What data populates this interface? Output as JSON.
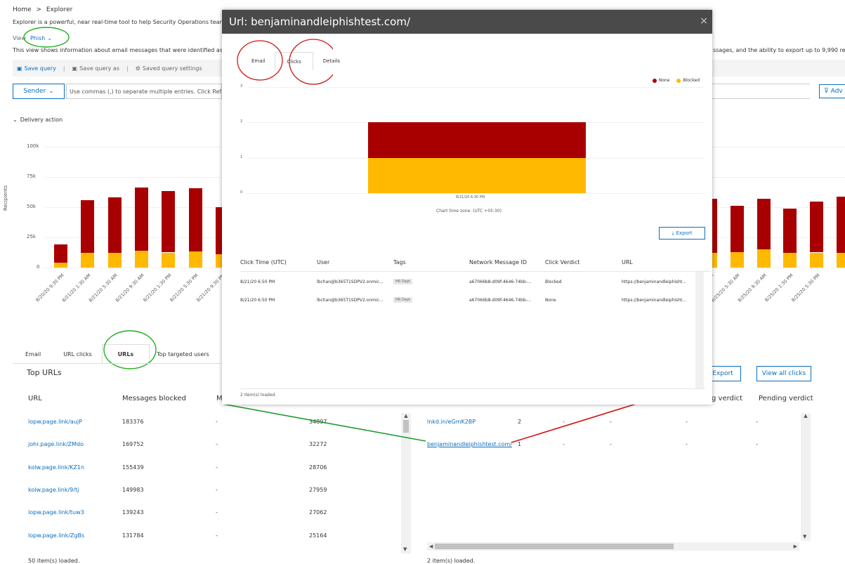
{
  "bg": {
    "breadcrumb": {
      "home": "Home",
      "sep": ">",
      "current": "Explorer"
    },
    "intro": "Explorer is a powerful, near real-time tool to help Security Operations team",
    "view_label": "View",
    "view_value": "Phish",
    "desc_left": "This view shows information about email messages that were identified as",
    "desc_right": "ssages, and the ability to export up to 9,990 rec",
    "toolbar": {
      "save_query": "Save query",
      "save_query_as": "Save query as",
      "saved_settings": "Saved query settings"
    },
    "filter": {
      "sender": "Sender",
      "placeholder": "Use commas (,) to separate multiple entries. Click Refr",
      "advanced": "Adv"
    },
    "delivery_action": "Delivery action",
    "chart": {
      "ylabel": "Recipients",
      "yticks": [
        "100k",
        "75k",
        "50k",
        "25k",
        "0"
      ],
      "ymax": 100000,
      "colors": {
        "red": "#a80000",
        "yellow": "#ffb900"
      },
      "left_bars": [
        {
          "red": 15000,
          "yellow": 4000
        },
        {
          "red": 44000,
          "yellow": 12000
        },
        {
          "red": 46000,
          "yellow": 12000
        },
        {
          "red": 52000,
          "yellow": 14000
        },
        {
          "red": 51000,
          "yellow": 12500
        },
        {
          "red": 52000,
          "yellow": 13500
        },
        {
          "red": 39000,
          "yellow": 11000
        }
      ],
      "left_xticks": [
        "8/20/20 9:30 PM",
        "8/21/20 1:30 AM",
        "8/21/20 5:30 AM",
        "8/21/20 9:30 AM",
        "8/21/20 1:30 PM",
        "8/21/20 5:30 PM",
        "8/21/20 9:30 PM"
      ],
      "right_bars": [
        {
          "red": 45000,
          "yellow": 12000
        },
        {
          "red": 38000,
          "yellow": 13000
        },
        {
          "red": 42000,
          "yellow": 15000
        },
        {
          "red": 37000,
          "yellow": 12000
        },
        {
          "red": 42000,
          "yellow": 12500
        },
        {
          "red": 47000,
          "yellow": 12000
        }
      ],
      "right_xticks": [
        "8/25/20 1:30 AM",
        "8/25/20 5:30 AM",
        "8/25/20 9:30 AM",
        "8/25/20 1:30 PM",
        "8/25/20 5:30 PM"
      ]
    },
    "tabs": [
      "Email",
      "URL clicks",
      "URLs",
      "Top targeted users"
    ],
    "top_urls_title": "Top URLs",
    "table_headers": [
      "URL",
      "Messages blocked",
      "M"
    ],
    "rows": [
      {
        "url": "lopw.page.link/aujP",
        "blocked": "183376",
        "m": "-",
        "n": "34897"
      },
      {
        "url": "johr.page.link/ZMdo",
        "blocked": "169752",
        "m": "-",
        "n": "32272"
      },
      {
        "url": "kolw.page.link/KZ1n",
        "blocked": "155439",
        "m": "-",
        "n": "28706"
      },
      {
        "url": "kolw.page.link/9/tj",
        "blocked": "149983",
        "m": "-",
        "n": "27959"
      },
      {
        "url": "lopw.page.link/tuw3",
        "blocked": "139243",
        "m": "-",
        "n": "27062"
      },
      {
        "url": "lopw.page.link/ZgBs",
        "blocked": "131784",
        "m": "-",
        "n": "25164"
      }
    ],
    "left_footer": "50 item(s) loaded.",
    "right_buttons": {
      "export": "Export",
      "view_all": "View all clicks"
    },
    "right_headers": [
      "g verdict",
      "Pending verdict"
    ],
    "right_rows": [
      {
        "url": "lnkd.in/eGmK2BP",
        "count": "2",
        "c1": "-",
        "c2": "-",
        "c3": "-",
        "c4": "-"
      },
      {
        "url": "benjaminandleiphishtest.com/",
        "count": "1",
        "c1": "-",
        "c2": "-",
        "c3": "-",
        "c4": "-"
      }
    ],
    "right_footer": "2 item(s) loaded."
  },
  "modal": {
    "title": "Url: benjaminandleiphishtest.com/",
    "close": "×",
    "tabs": [
      "Email",
      "Clicks",
      "Details"
    ],
    "legend": [
      {
        "name": "None",
        "color": "#a80000"
      },
      {
        "name": "Blocked",
        "color": "#ffb900"
      }
    ],
    "chart": {
      "yticks": [
        "3",
        "2",
        "1",
        "0"
      ],
      "ymax": 3,
      "bar": {
        "red": 1,
        "yellow": 1
      },
      "xtick": "8/21/20 6:30 PM",
      "timezone": "Chart time zone: (UTC +05:30)"
    },
    "export": "Export",
    "headers": [
      "Click Time (UTC)",
      "User",
      "Tags",
      "Network Message ID",
      "Click Verdict",
      "URL"
    ],
    "rows": [
      {
        "time": "8/21/20 6:50 PM",
        "user": "lbchan@b365T1SDPV2.onmic...",
        "tag": "HR Dept",
        "nmid": "a67066b8-d09f-4646-74bb-...",
        "verdict": "Blocked",
        "url": "https://benjaminandleiphisht..."
      },
      {
        "time": "8/21/20 6:50 PM",
        "user": "lbchan@b365T1SDPV2.onmic...",
        "tag": "HR Dept",
        "nmid": "a67066b8-d09f-4646-74bb-...",
        "verdict": "None",
        "url": "https://benjaminandleiphisht..."
      }
    ],
    "footer": "2 item(s) loaded."
  }
}
